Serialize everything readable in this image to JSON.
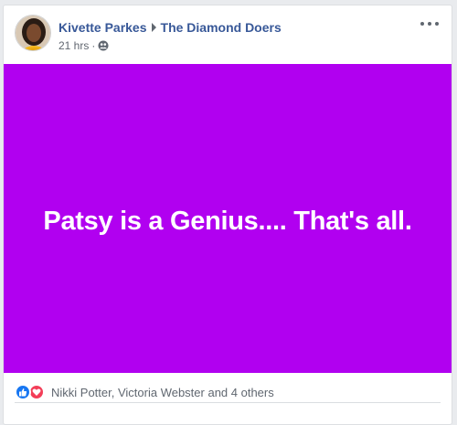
{
  "post": {
    "author": "Kivette Parkes",
    "group": "The Diamond Doers",
    "timestamp": "21 hrs",
    "separator": "·",
    "privacy_icon": "group-icon",
    "more_icon": "more-options-icon",
    "text": "Patsy is a Genius.... That's all.",
    "background_color": "#b100f0"
  },
  "reactions": {
    "icons": [
      "like-icon",
      "love-icon"
    ],
    "summary": "Nikki Potter, Victoria Webster and 4 others"
  }
}
